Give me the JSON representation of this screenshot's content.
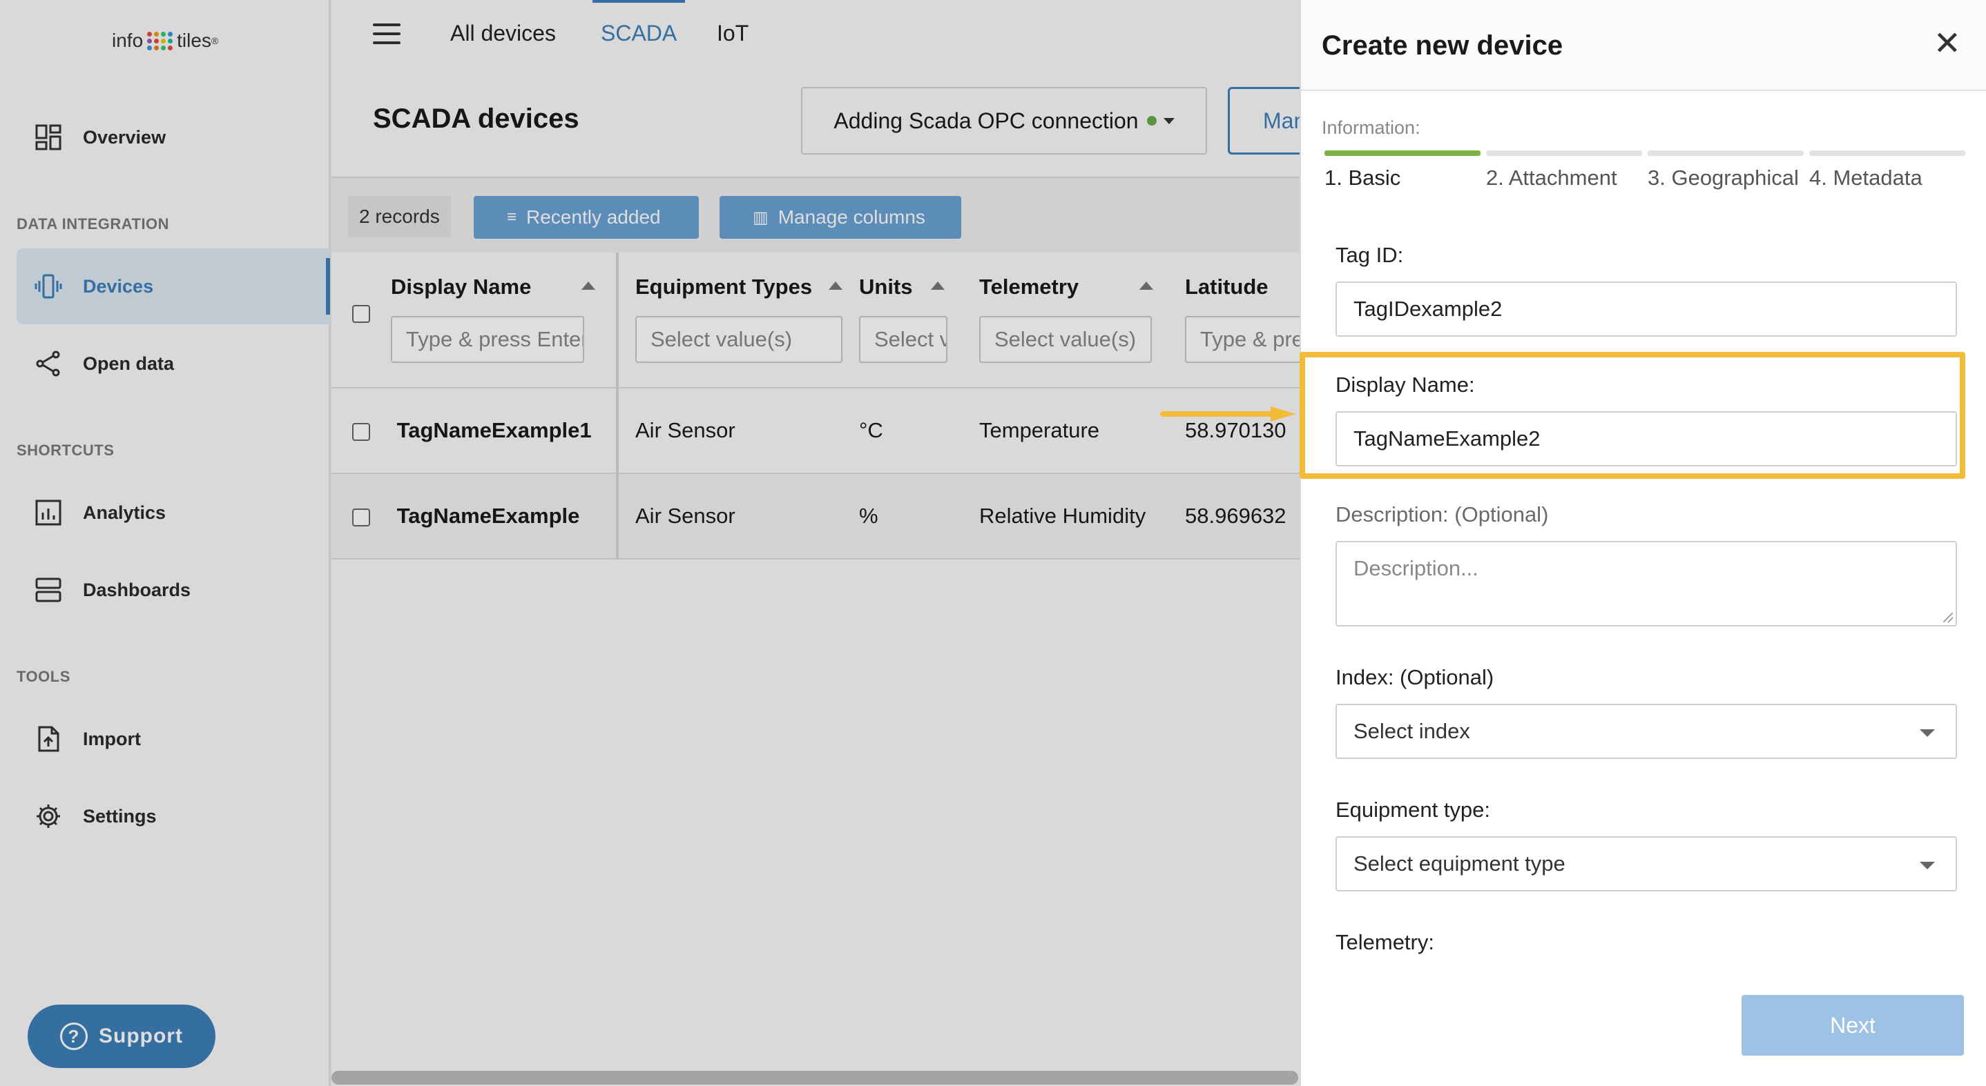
{
  "sidebar": {
    "logo": {
      "left": "info",
      "right": "tiles",
      "mark": "®"
    },
    "overview": "Overview",
    "section_data": "DATA INTEGRATION",
    "devices": "Devices",
    "open_data": "Open data",
    "section_shortcuts": "SHORTCUTS",
    "analytics": "Analytics",
    "dashboards": "Dashboards",
    "section_tools": "TOOLS",
    "import": "Import",
    "settings": "Settings",
    "support": "Support"
  },
  "topnav": {
    "all_devices": "All devices",
    "scada": "SCADA",
    "iot": "IoT"
  },
  "page": {
    "title": "SCADA devices",
    "connection": "Adding Scada OPC connection",
    "manage_partial": "Manage"
  },
  "toolbar": {
    "records": "2 records",
    "recently_added": "Recently added",
    "manage_columns": "Manage columns"
  },
  "table": {
    "headers": {
      "display_name": "Display Name",
      "equipment_types": "Equipment Types",
      "units": "Units",
      "telemetry": "Telemetry",
      "latitude": "Latitude"
    },
    "filters": {
      "display_name": "Type & press Enter",
      "equipment_types": "Select value(s)",
      "units": "Select value(s)",
      "telemetry": "Select value(s)",
      "latitude": "Type & press Enter"
    },
    "rows": [
      {
        "display_name": "TagNameExample1",
        "equipment": "Air Sensor",
        "units": "°C",
        "telemetry": "Temperature",
        "latitude": "58.970130"
      },
      {
        "display_name": "TagNameExample",
        "equipment": "Air Sensor",
        "units": "%",
        "telemetry": "Relative Humidity",
        "latitude": "58.969632"
      }
    ]
  },
  "drawer": {
    "title": "Create new device",
    "close": "✕",
    "information_label": "Information:",
    "steps": [
      "1. Basic",
      "2. Attachment",
      "3. Geographical",
      "4. Metadata"
    ],
    "tag_id_label": "Tag ID:",
    "tag_id_value": "TagIDexample2",
    "display_name_label": "Display Name:",
    "display_name_value": "TagNameExample2",
    "description_label": "Description: (Optional)",
    "description_placeholder": "Description...",
    "index_label": "Index: (Optional)",
    "index_placeholder": "Select index",
    "equipment_label": "Equipment type:",
    "equipment_placeholder": "Select equipment type",
    "telemetry_label": "Telemetry:",
    "next": "Next"
  },
  "colors": {
    "accent": "#3d7fb8",
    "step_active": "#7cb342",
    "highlight": "#f2bb38",
    "connection_dot": "#6aa84f"
  },
  "icons": {
    "overview": "dashboard-grid-icon",
    "devices": "device-vibrate-icon",
    "open_data": "share-icon",
    "analytics": "bar-chart-icon",
    "dashboards": "stacked-layers-icon",
    "import": "file-upload-icon",
    "settings": "gear-icon",
    "support": "question-circle-icon"
  }
}
